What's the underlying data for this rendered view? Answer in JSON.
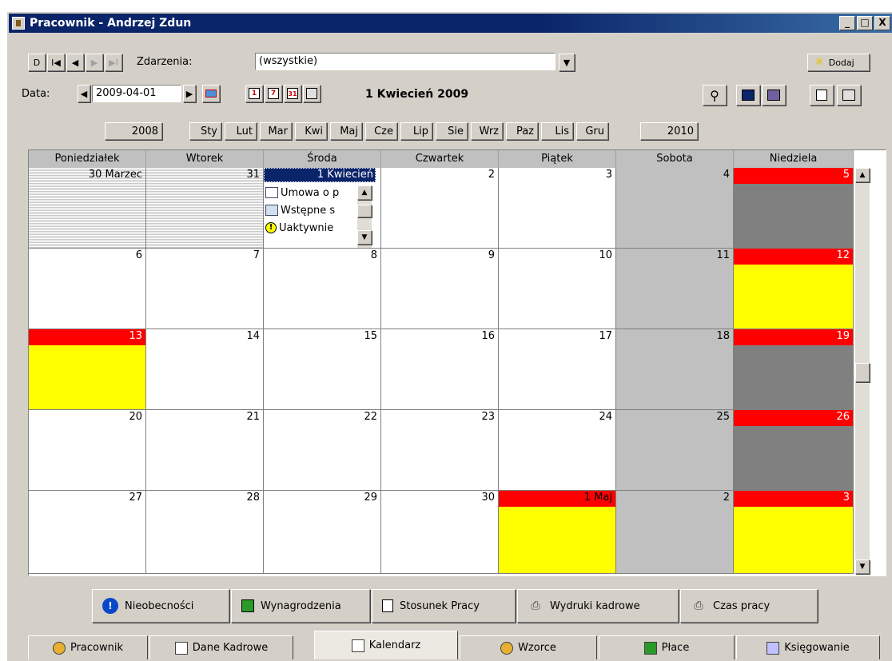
{
  "window": {
    "title": "Pracownik - Andrzej Zdun",
    "controls": [
      "_",
      "□",
      "X"
    ]
  },
  "toolbar": {
    "nav_buttons": [
      "D",
      "I◀",
      "◀",
      "▶",
      "▶I"
    ],
    "events_label": "Zdarzenia:",
    "events_value": "(wszystkie)",
    "add_label": "Dodaj",
    "date_label": "Data:",
    "date_value": "2009-04-01",
    "current_date": "1 Kwiecień 2009"
  },
  "months": {
    "prev_year": "2008",
    "next_year": "2010",
    "items": [
      "Sty",
      "Lut",
      "Mar",
      "Kwi",
      "Maj",
      "Cze",
      "Lip",
      "Sie",
      "Wrz",
      "Paz",
      "Lis",
      "Gru"
    ]
  },
  "weekdays": [
    "Poniedziałek",
    "Wtorek",
    "Środa",
    "Czwartek",
    "Piątek",
    "Sobota",
    "Niedziela"
  ],
  "weeks": [
    [
      "30 Marzec",
      "31",
      "1 Kwiecień",
      "2",
      "3",
      "4",
      "5"
    ],
    [
      "6",
      "7",
      "8",
      "9",
      "10",
      "11",
      "12"
    ],
    [
      "13",
      "14",
      "15",
      "16",
      "17",
      "18",
      "19"
    ],
    [
      "20",
      "21",
      "22",
      "23",
      "24",
      "25",
      "26"
    ],
    [
      "27",
      "28",
      "29",
      "30",
      "1 Maj",
      "2",
      "3"
    ]
  ],
  "events": [
    "Umowa o p",
    "Wstępne s",
    "Uaktywnie"
  ],
  "bottom_buttons": [
    "Nieobecności",
    "Wynagrodzenia",
    "Stosunek Pracy",
    "Wydruki kadrowe",
    "Czas pracy"
  ],
  "tabs": [
    "Pracownik",
    "Dane Kadrowe",
    "Kalendarz",
    "Wzorce",
    "Płace",
    "Księgowanie"
  ],
  "colors": {
    "holiday": "#ff0000",
    "free_day": "#ffff00",
    "selected": "#0a246a",
    "weekend": "#c0c0c0",
    "dark": "#808080"
  }
}
